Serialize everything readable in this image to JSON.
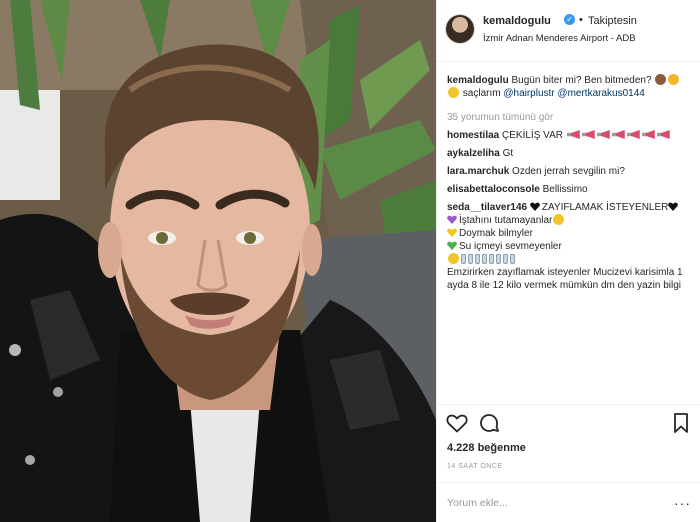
{
  "header": {
    "username": "kemaldogulu",
    "separator": "•",
    "follow_label": "Takiptesin",
    "location": "İzmir Adnan Menderes Airport - ADB"
  },
  "caption": {
    "username": "kemaldogulu",
    "text_1": "Bugün biter mi? Ben bitmeden?",
    "text_2": "saçlarım",
    "mention_1": "@hairplustr",
    "mention_2": "@mertkarakus0144"
  },
  "view_all_comments": "35 yorumun tümünü gör",
  "comments": [
    {
      "username": "homestilaa",
      "text": "ÇEKİLİŞ VAR"
    },
    {
      "username": "aykalzeliha",
      "text": "Gt"
    },
    {
      "username": "lara.marchuk",
      "text": "Ozden jerrah sevgilin mi?"
    },
    {
      "username": "elisabettaloconsole",
      "text": "Bellissimo"
    },
    {
      "username": "seda__tilaver146",
      "text": "ZAYIFLAMAK İSTEYENLER",
      "lines": [
        "İştahını tutamayanlar",
        "Doymak bilmyler",
        "Su içmeyi sevmeyenler"
      ],
      "tail": "Emzirirken zayıflamak isteyenler Mucizevi karisimla 1 ayda 8 ile 12 kilo vermek mümkün dm den yazin bilgi"
    }
  ],
  "likes": "4.228 beğenme",
  "time": "14 SAAT ÖNCE",
  "comment_input": {
    "placeholder": "Yorum ekle...",
    "more": "···"
  },
  "colors": {
    "text": "#262626",
    "muted": "#999999",
    "verified": "#3897f0",
    "link": "#003569",
    "border": "#efefef"
  },
  "icons": [
    "heart-icon",
    "comment-icon",
    "bookmark-icon",
    "verified-badge-icon",
    "more-options-icon"
  ]
}
